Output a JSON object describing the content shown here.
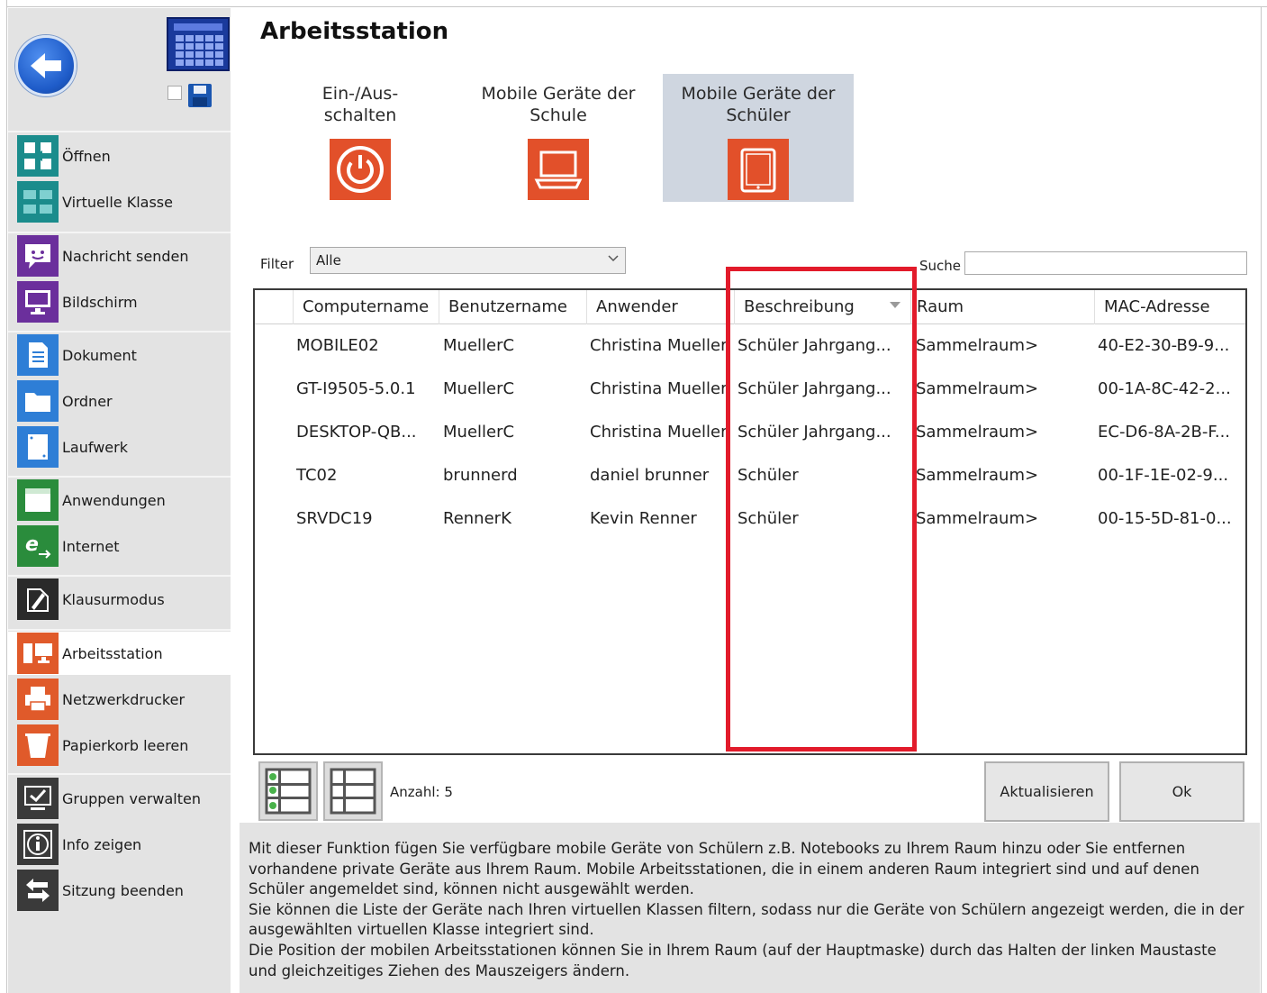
{
  "sidebar": {
    "items": [
      {
        "label": "Öffnen",
        "icon": "open-icon"
      },
      {
        "label": "Virtuelle Klasse",
        "icon": "virtual-class-icon"
      },
      {
        "label": "Nachricht senden",
        "icon": "message-icon"
      },
      {
        "label": "Bildschirm",
        "icon": "monitor-icon"
      },
      {
        "label": "Dokument",
        "icon": "document-icon"
      },
      {
        "label": "Ordner",
        "icon": "folder-icon"
      },
      {
        "label": "Laufwerk",
        "icon": "drive-icon"
      },
      {
        "label": "Anwendungen",
        "icon": "applications-icon"
      },
      {
        "label": "Internet",
        "icon": "internet-icon"
      },
      {
        "label": "Klausurmodus",
        "icon": "exam-mode-icon"
      },
      {
        "label": "Arbeitsstation",
        "icon": "workstation-icon"
      },
      {
        "label": "Netzwerkdrucker",
        "icon": "printer-icon"
      },
      {
        "label": "Papierkorb leeren",
        "icon": "trash-icon"
      },
      {
        "label": "Gruppen verwalten",
        "icon": "groups-icon"
      },
      {
        "label": "Info zeigen",
        "icon": "info-icon"
      },
      {
        "label": "Sitzung beenden",
        "icon": "logout-icon"
      }
    ]
  },
  "page": {
    "title": "Arbeitsstation"
  },
  "modes": [
    {
      "label_line1": "Ein-/Aus-",
      "label_line2": "schalten",
      "icon": "power-icon"
    },
    {
      "label_line1": "Mobile Geräte der",
      "label_line2": "Schule",
      "icon": "laptop-icon"
    },
    {
      "label_line1": "Mobile Geräte der",
      "label_line2": "Schüler",
      "icon": "tablet-icon"
    }
  ],
  "filter": {
    "label": "Filter",
    "value": "Alle"
  },
  "search": {
    "label": "Suche",
    "value": ""
  },
  "table": {
    "columns": [
      "Computername",
      "Benutzername",
      "Anwender",
      "Beschreibung",
      "Raum",
      "MAC-Adresse"
    ],
    "rows": [
      [
        "MOBILE02",
        "MuellerC",
        "Christina Mueller",
        "Schüler Jahrgang...",
        "Sammelraum>",
        "40-E2-30-B9-9..."
      ],
      [
        "GT-I9505-5.0.1",
        "MuellerC",
        "Christina Mueller",
        "Schüler Jahrgang...",
        "Sammelraum>",
        "00-1A-8C-42-2..."
      ],
      [
        "DESKTOP-QB...",
        "MuellerC",
        "Christina Mueller",
        "Schüler Jahrgang...",
        "Sammelraum>",
        "EC-D6-8A-2B-F..."
      ],
      [
        "TC02",
        "brunnerd",
        "daniel brunner",
        "Schüler",
        "Sammelraum>",
        "00-1F-1E-02-9..."
      ],
      [
        "SRVDC19",
        "RennerK",
        "Kevin Renner",
        "Schüler",
        "Sammelraum>",
        "00-15-5D-81-0..."
      ]
    ]
  },
  "footer": {
    "count_label": "Anzahl: 5",
    "refresh_label": "Aktualisieren",
    "ok_label": "Ok"
  },
  "info": {
    "lines": [
      "Mit dieser Funktion fügen Sie verfügbare mobile Geräte von Schülern z.B. Notebooks zu Ihrem Raum hinzu oder Sie entfernen",
      "vorhandene private Geräte aus Ihrem Raum. Mobile Arbeitsstationen, die in einem anderen Raum integriert sind und auf denen",
      "Schüler angemeldet sind, können nicht ausgewählt werden.",
      "Sie können die Liste der Geräte nach Ihren virtuellen Klassen filtern, sodass nur die Geräte von Schülern angezeigt werden, die in der",
      "ausgewählten virtuellen Klasse integriert sind.",
      "Die Position der mobilen Arbeitsstationen können Sie in Ihrem Raum (auf der Hauptmaske) durch das Halten der linken Maustaste",
      "und gleichzeitiges Ziehen des Mauszeigers ändern."
    ]
  },
  "colors": {
    "accent_orange": "#e2502a",
    "highlight_red": "#e21b2b",
    "selected_tile": "#cfd6e0",
    "sidebar_bg": "#e3e3e3"
  }
}
